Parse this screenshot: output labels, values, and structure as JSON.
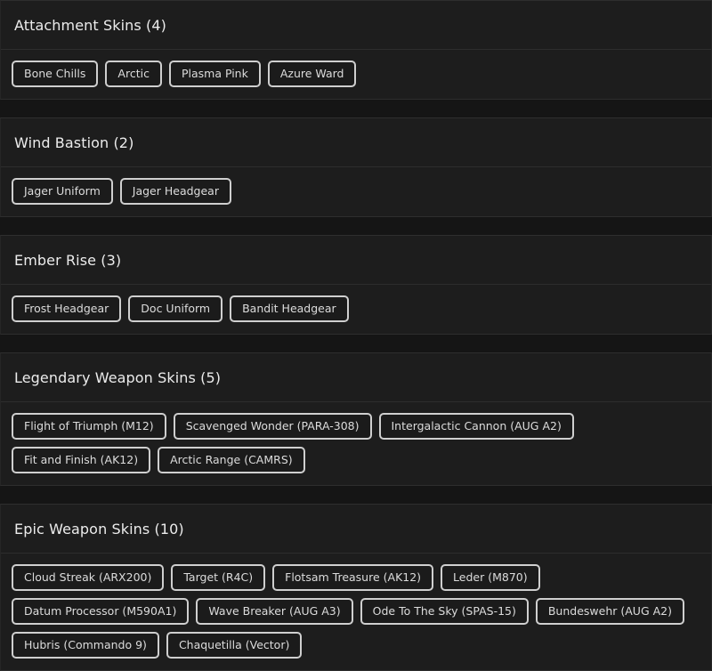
{
  "sections": [
    {
      "title": "Attachment Skins (4)",
      "items": [
        "Bone Chills",
        "Arctic",
        "Plasma Pink",
        "Azure Ward"
      ]
    },
    {
      "title": "Wind Bastion (2)",
      "items": [
        "Jager Uniform",
        "Jager Headgear"
      ]
    },
    {
      "title": "Ember Rise (3)",
      "items": [
        "Frost Headgear",
        "Doc Uniform",
        "Bandit Headgear"
      ]
    },
    {
      "title": "Legendary Weapon Skins (5)",
      "items": [
        "Flight of Triumph (M12)",
        "Scavenged Wonder (PARA-308)",
        "Intergalactic Cannon (AUG A2)",
        "Fit and Finish (AK12)",
        "Arctic Range (CAMRS)"
      ]
    },
    {
      "title": "Epic Weapon Skins (10)",
      "items": [
        "Cloud Streak (ARX200)",
        "Target (R4C)",
        "Flotsam Treasure (AK12)",
        "Leder (M870)",
        "Datum Processor (M590A1)",
        "Wave Breaker (AUG A3)",
        "Ode To The Sky (SPAS-15)",
        "Bundeswehr (AUG A2)",
        "Hubris (Commando 9)",
        "Chaquetilla (Vector)"
      ]
    }
  ]
}
